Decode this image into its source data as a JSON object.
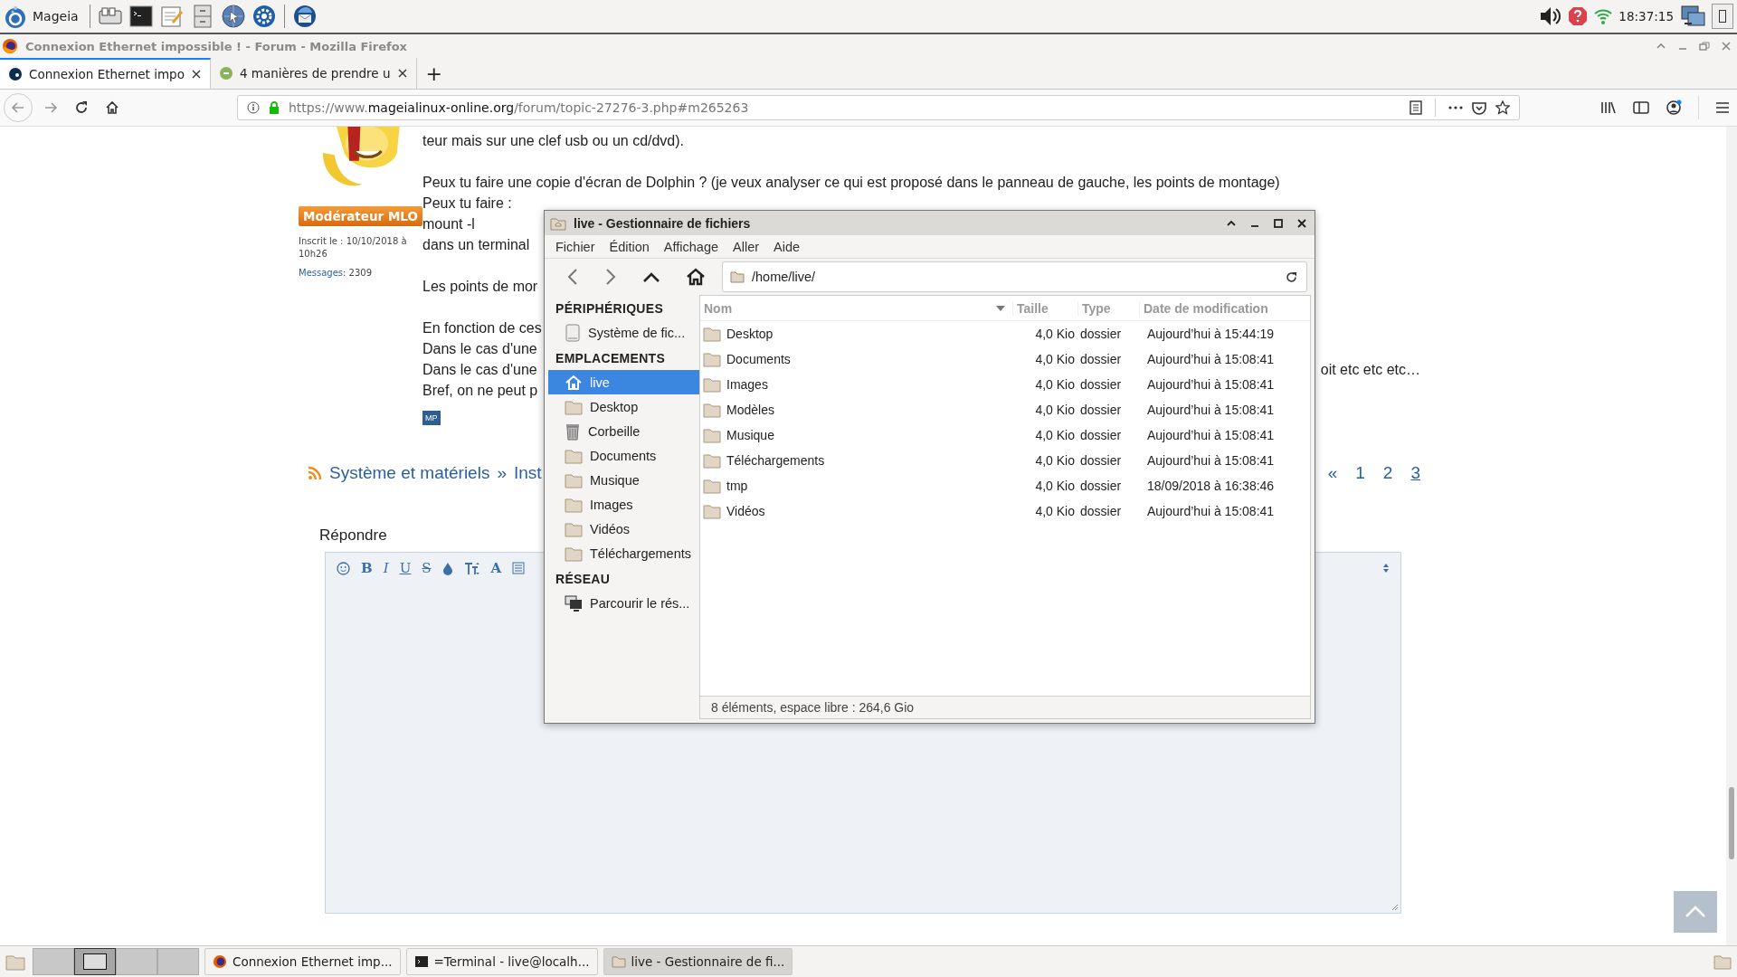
{
  "top_panel": {
    "menu_label": "Mageia",
    "clock": "18:37:15"
  },
  "browser": {
    "title": "Connexion Ethernet impossible ! - Forum - Mozilla Firefox",
    "tabs": [
      {
        "label": "Connexion Ethernet impo",
        "selected": true
      },
      {
        "label": "4 manières de prendre u",
        "selected": false
      }
    ],
    "new_tab": "+",
    "url": {
      "scheme": "https://www.",
      "domain": "mageialinux-online.org",
      "path": "/forum/topic-27276-3.php#m265263"
    }
  },
  "post": {
    "author": {
      "rank": "Modérateur MLO",
      "registered": "Inscrit le : 10/10/2018 à 10h26",
      "messages_label": "Messages",
      "messages_count": ": 2309"
    },
    "paragraphs": [
      [
        {
          "text": "teur mais sur une clef usb ou un cd/dvd)."
        }
      ],
      [
        {
          "text": "Peux tu faire une copie d'écran de Dolphin ? (je veux analyser ce qui est proposé dans le panneau de gauche, les points de montage)"
        },
        {
          "text": "Peux tu faire :"
        },
        {
          "text": "mount -l"
        },
        {
          "text": "dans un terminal"
        }
      ],
      [
        {
          "text": "Les points de mor"
        }
      ],
      [
        {
          "text": "En fonction de ces"
        },
        {
          "text": "Dans le cas d'une"
        },
        {
          "text": "Dans le cas d'une",
          "right": "oit etc etc etc…"
        },
        {
          "text": "Bref, on ne peut p"
        }
      ]
    ],
    "mp": "MP"
  },
  "breadcrumb": {
    "items": [
      "Système et matériels",
      "Inst"
    ],
    "separator": "»"
  },
  "pagination": {
    "prev": "«",
    "pages": [
      {
        "label": "1",
        "selected": false
      },
      {
        "label": "2",
        "selected": false
      },
      {
        "label": "3",
        "selected": true
      }
    ]
  },
  "reply": {
    "title": "Répondre",
    "toolbar": [
      {
        "kind": "smiley"
      },
      {
        "kind": "bold",
        "label": "B"
      },
      {
        "kind": "italic",
        "label": "I"
      },
      {
        "kind": "underline",
        "label": "U"
      },
      {
        "kind": "strike",
        "label": "S"
      },
      {
        "kind": "color"
      },
      {
        "kind": "size"
      },
      {
        "kind": "font",
        "label": "A"
      },
      {
        "kind": "list"
      }
    ]
  },
  "file_manager": {
    "title": "live - Gestionnaire de fichiers",
    "menu": [
      "Fichier",
      "Édition",
      "Affichage",
      "Aller",
      "Aide"
    ],
    "path": "/home/live/",
    "sidebar": [
      {
        "heading": "PÉRIPHÉRIQUES",
        "items": [
          {
            "label": "Système de fic...",
            "kind": "drive",
            "selected": false
          }
        ]
      },
      {
        "heading": "EMPLACEMENTS",
        "items": [
          {
            "label": "live",
            "kind": "home",
            "selected": true
          },
          {
            "label": "Desktop",
            "kind": "folder",
            "selected": false
          },
          {
            "label": "Corbeille",
            "kind": "trash",
            "selected": false
          },
          {
            "label": "Documents",
            "kind": "folder",
            "selected": false
          },
          {
            "label": "Musique",
            "kind": "folder",
            "selected": false
          },
          {
            "label": "Images",
            "kind": "folder",
            "selected": false
          },
          {
            "label": "Vidéos",
            "kind": "folder",
            "selected": false
          },
          {
            "label": "Téléchargements",
            "kind": "folder",
            "selected": false
          }
        ]
      },
      {
        "heading": "RÉSEAU",
        "items": [
          {
            "label": "Parcourir le rés...",
            "kind": "network",
            "selected": false
          }
        ]
      }
    ],
    "columns": [
      "Nom",
      "Taille",
      "Type",
      "Date de modification"
    ],
    "rows": [
      {
        "name": "Desktop",
        "size": "4,0 Kio",
        "type": "dossier",
        "modified": "Aujourd’hui à 15:44:19"
      },
      {
        "name": "Documents",
        "size": "4,0 Kio",
        "type": "dossier",
        "modified": "Aujourd’hui à 15:08:41"
      },
      {
        "name": "Images",
        "size": "4,0 Kio",
        "type": "dossier",
        "modified": "Aujourd’hui à 15:08:41"
      },
      {
        "name": "Modèles",
        "size": "4,0 Kio",
        "type": "dossier",
        "modified": "Aujourd’hui à 15:08:41"
      },
      {
        "name": "Musique",
        "size": "4,0 Kio",
        "type": "dossier",
        "modified": "Aujourd’hui à 15:08:41"
      },
      {
        "name": "Téléchargements",
        "size": "4,0 Kio",
        "type": "dossier",
        "modified": "Aujourd’hui à 15:08:41"
      },
      {
        "name": "tmp",
        "size": "4,0 Kio",
        "type": "dossier",
        "modified": "18/09/2018 à 16:38:46"
      },
      {
        "name": "Vidéos",
        "size": "4,0 Kio",
        "type": "dossier",
        "modified": "Aujourd’hui à 15:08:41"
      }
    ],
    "status": "8 éléments, espace libre : 264,6 Gio"
  },
  "taskbar": {
    "workspaces": [
      {
        "selected": false
      },
      {
        "selected": true
      },
      {
        "selected": false
      },
      {
        "selected": false
      }
    ],
    "tasks": [
      {
        "label": "Connexion Ethernet imp...",
        "selected": false
      },
      {
        "label": "=Terminal - live@localh...",
        "selected": false
      },
      {
        "label": "live - Gestionnaire de fi...",
        "selected": true
      }
    ]
  }
}
